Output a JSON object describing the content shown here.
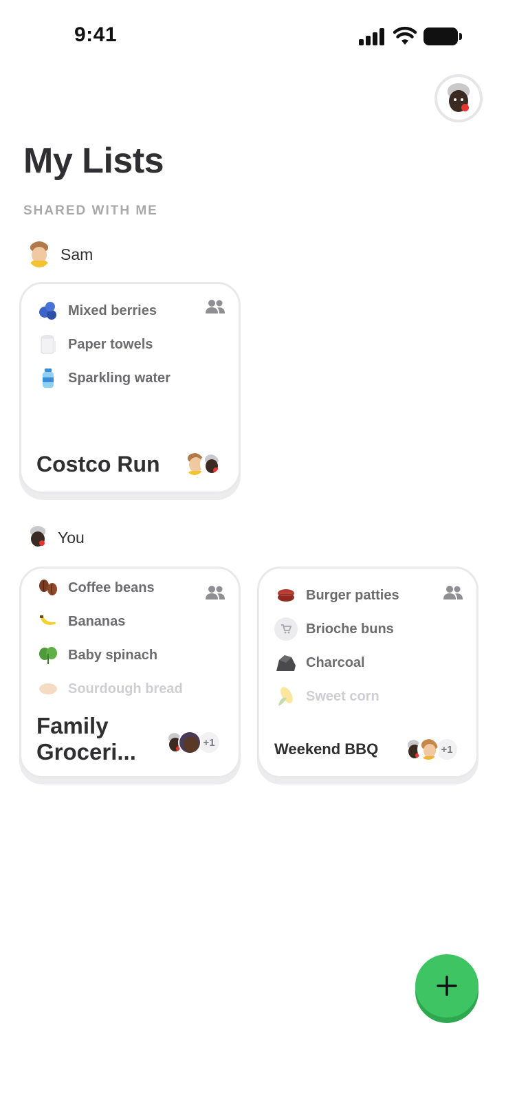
{
  "status_bar": {
    "time": "9:41"
  },
  "header": {
    "title": "My Lists",
    "profile_avatar": "memoji-avatar"
  },
  "section": {
    "label": "SHARED WITH ME"
  },
  "groups": [
    {
      "owner": "Sam",
      "lists": [
        {
          "title": "Costco Run",
          "items": [
            {
              "icon": "blueberries-icon",
              "label": "Mixed berries"
            },
            {
              "icon": "paper-towel-icon",
              "label": "Paper towels"
            },
            {
              "icon": "water-bottle-icon",
              "label": "Sparkling water"
            }
          ],
          "extra_members": ""
        }
      ]
    },
    {
      "owner": "You",
      "lists": [
        {
          "title": "Family Groceri...",
          "items": [
            {
              "icon": "coffee-beans-icon",
              "label": "Coffee beans"
            },
            {
              "icon": "banana-icon",
              "label": "Bananas"
            },
            {
              "icon": "spinach-icon",
              "label": "Baby spinach"
            },
            {
              "icon": "bread-icon",
              "label": "Sourdough bread"
            }
          ],
          "extra_members": "+1"
        },
        {
          "title": "Weekend BBQ",
          "items": [
            {
              "icon": "burger-patty-icon",
              "label": "Burger patties"
            },
            {
              "icon": "shopping-cart-icon",
              "label": "Brioche buns"
            },
            {
              "icon": "charcoal-icon",
              "label": "Charcoal"
            },
            {
              "icon": "corn-icon",
              "label": "Sweet corn"
            }
          ],
          "extra_members": "+1"
        }
      ]
    }
  ],
  "fab": {
    "icon": "plus-icon"
  },
  "colors": {
    "accent": "#3fc464",
    "card_border": "#e9e9eb",
    "muted_text": "#6c6c70"
  }
}
